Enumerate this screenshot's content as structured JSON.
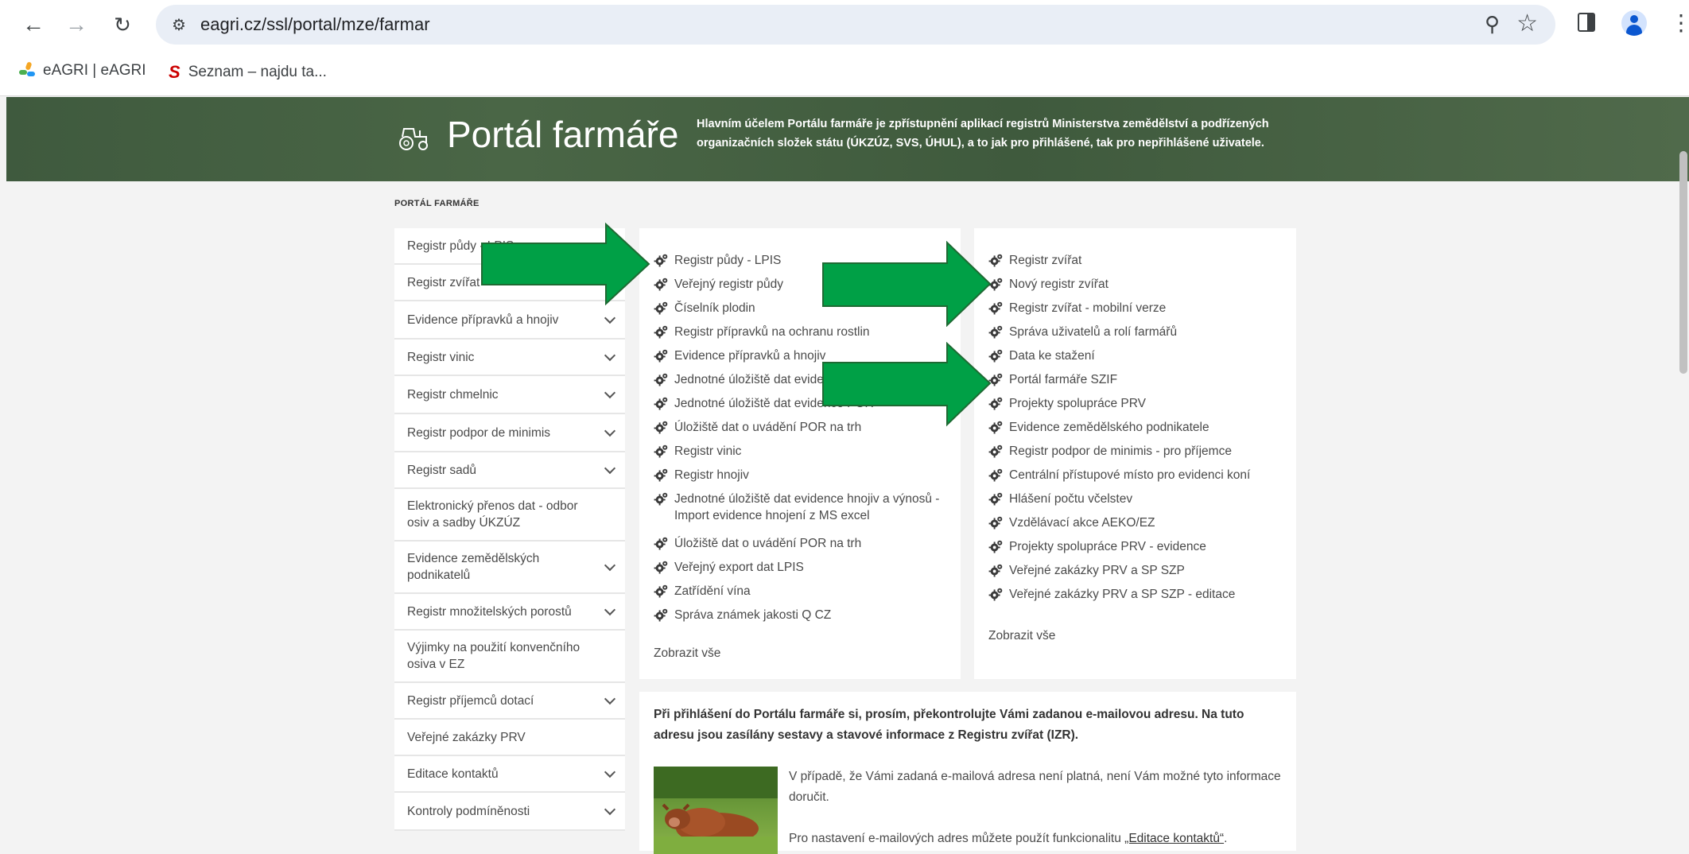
{
  "browser": {
    "url": "eagri.cz/ssl/portal/mze/farmar",
    "bookmarks": [
      "eAGRI | eAGRI",
      "Seznam – najdu ta..."
    ]
  },
  "banner": {
    "title": "Portál farmáře",
    "text": "Hlavním účelem Portálu farmáře je zpřístupnění aplikací registrů Ministerstva zemědělství a podřízených organizačních složek státu (ÚKZÚZ, SVS, ÚHUL), a to jak pro přihlášené, tak pro nepřihlášené uživatele."
  },
  "breadcrumb": "PORTÁL FARMÁŘE",
  "sidebar": {
    "items": [
      {
        "label": "Registr půdy - LPIS",
        "has_chevron": false
      },
      {
        "label": "Registr zvířat",
        "has_chevron": false
      },
      {
        "label": "Evidence přípravků a hnojiv",
        "has_chevron": true
      },
      {
        "label": "Registr vinic",
        "has_chevron": true
      },
      {
        "label": "Registr chmelnic",
        "has_chevron": true
      },
      {
        "label": "Registr podpor de minimis",
        "has_chevron": true
      },
      {
        "label": "Registr sadů",
        "has_chevron": true
      },
      {
        "label": "Elektronický přenos dat - odbor osiv a sadby ÚKZÚZ",
        "has_chevron": false
      },
      {
        "label": "Evidence zemědělských podnikatelů",
        "has_chevron": true
      },
      {
        "label": "Registr množitelských porostů",
        "has_chevron": true
      },
      {
        "label": "Výjimky na použití konvenčního osiva v EZ",
        "has_chevron": false
      },
      {
        "label": "Registr příjemců dotací",
        "has_chevron": true
      },
      {
        "label": "Veřejné zakázky PRV",
        "has_chevron": false
      },
      {
        "label": "Editace kontaktů",
        "has_chevron": true
      },
      {
        "label": "Kontroly podmíněnosti",
        "has_chevron": true
      }
    ]
  },
  "panel_left": {
    "links": [
      {
        "label": "Registr půdy - LPIS"
      },
      {
        "label": "Veřejný registr půdy"
      },
      {
        "label": "Číselník plodin"
      },
      {
        "label": "Registr přípravků na ochranu rostlin"
      },
      {
        "label": "Evidence přípravků a hnojiv"
      },
      {
        "label": "Jednotné úložiště dat evidence hnojiv"
      },
      {
        "label": "Jednotné úložiště dat evidence POR"
      },
      {
        "label": "Úložiště dat o uvádění POR na trh"
      },
      {
        "label": "Registr vinic"
      },
      {
        "label": "Registr hnojiv"
      },
      {
        "label": "Jednotné úložiště dat evidence hnojiv a výnosů - Import evidence hnojení z MS excel"
      },
      {
        "label": "Úložiště dat o uvádění POR na trh"
      },
      {
        "label": "Veřejný export dat LPIS"
      },
      {
        "label": "Zatřídění vína"
      },
      {
        "label": "Správa známek jakosti Q CZ"
      }
    ],
    "show_all": "Zobrazit vše"
  },
  "panel_right": {
    "links": [
      {
        "label": "Registr zvířat"
      },
      {
        "label": "Nový registr zvířat"
      },
      {
        "label": "Registr zvířat - mobilní verze"
      },
      {
        "label": "Správa uživatelů a rolí farmářů"
      },
      {
        "label": "Data ke stažení"
      },
      {
        "label": "Portál farmáře SZIF"
      },
      {
        "label": "Projekty spolupráce PRV"
      },
      {
        "label": "Evidence zemědělského podnikatele"
      },
      {
        "label": "Registr podpor de minimis - pro příjemce"
      },
      {
        "label": "Centrální přístupové místo pro evidenci koní"
      },
      {
        "label": "Hlášení počtu včelstev"
      },
      {
        "label": "Vzdělávací akce AEKO/EZ"
      },
      {
        "label": "Projekty spolupráce PRV - evidence"
      },
      {
        "label": "Veřejné zakázky PRV a SP SZP"
      },
      {
        "label": "Veřejné zakázky PRV a SP SZP - editace"
      }
    ],
    "show_all": "Zobrazit vše"
  },
  "info": {
    "bold": "Při přihlášení do Portálu farmáře si, prosím, překontrolujte Vámi zadanou e-mailovou adresu. Na tuto adresu jsou zasílány sestavy a stavové informace z Registru zvířat (IZR).",
    "p1": "V případě, že Vámi zadaná e-mailová adresa není platná, není Vám možné tyto informace doručit.",
    "p2_prefix": "Pro nastavení e-mailových adres můžete použít funkcionalitu ",
    "p2_link": "„Editace kontaktů“",
    "p2_suffix": "."
  },
  "colors": {
    "banner": "#455f43",
    "arrow": "#00a046",
    "arrow_border": "#1e6a33"
  }
}
